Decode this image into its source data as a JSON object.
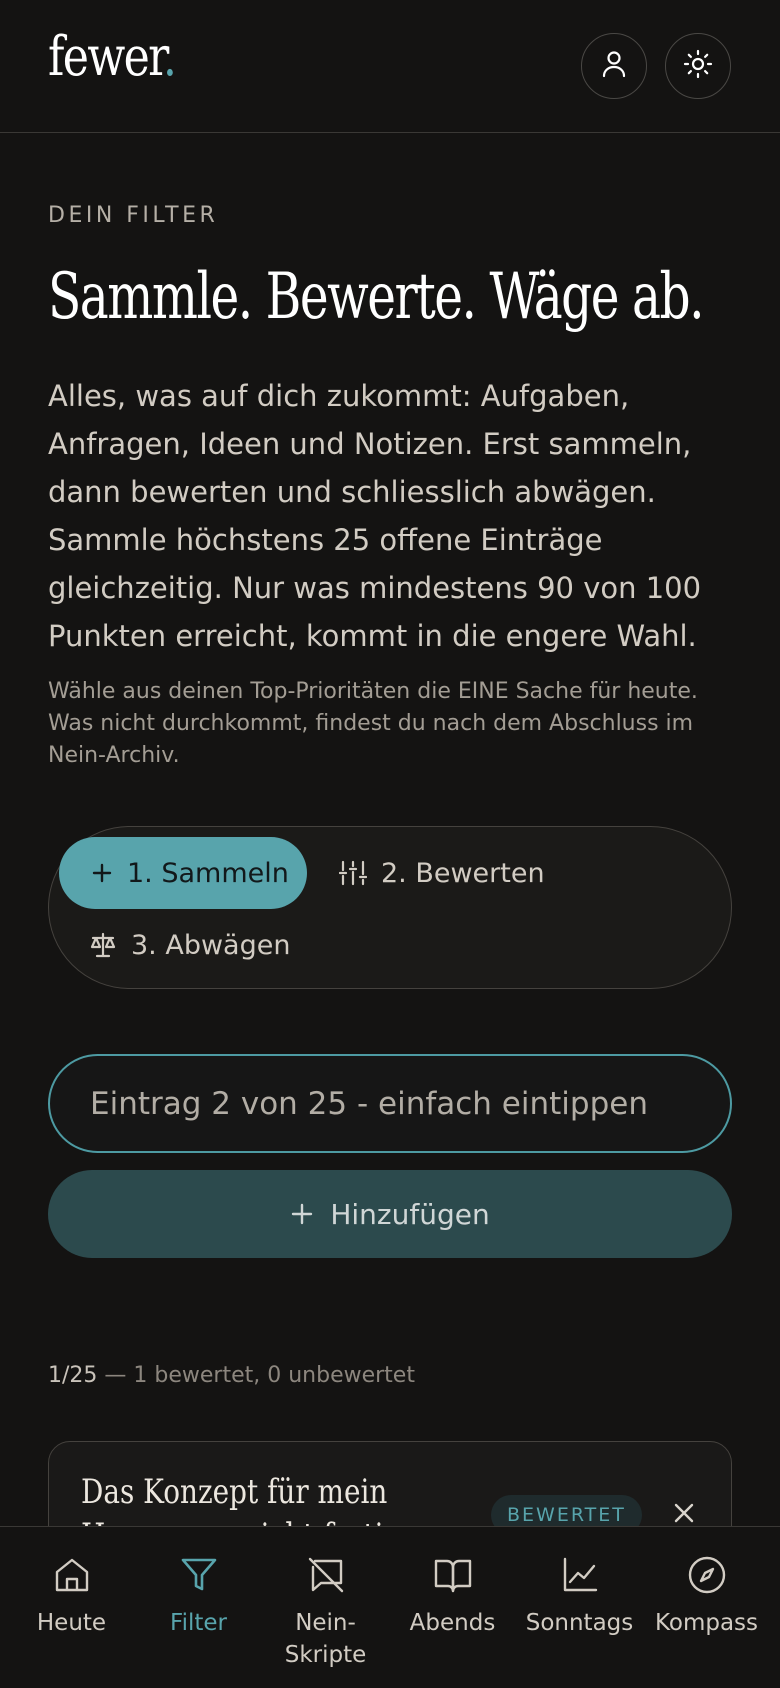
{
  "app": {
    "logo_text": "fewer",
    "logo_dot": "."
  },
  "header": {
    "user_icon": "user-icon",
    "theme_icon": "sun-icon"
  },
  "intro": {
    "eyebrow": "DEIN FILTER",
    "headline": "Sammle. Bewerte. Wäge ab.",
    "lead": "Alles, was auf dich zukommt: Aufgaben, Anfragen, Ideen und Notizen. Erst sammeln, dann bewerten und schliesslich abwägen. Sammle höchstens 25 offene Einträge gleichzeitig. Nur was mindestens 90 von 100 Punkten erreicht, kommt in die engere Wahl.",
    "note": "Wähle aus deinen Top-Prioritäten die EINE Sache für heute. Was nicht durchkommt, findest du nach dem Abschluss im Nein-Archiv."
  },
  "steps": [
    {
      "label": "1. Sammeln",
      "icon": "plus-icon",
      "active": true
    },
    {
      "label": "2. Bewerten",
      "icon": "sliders-icon",
      "active": false
    },
    {
      "label": "3. Abwägen",
      "icon": "scale-icon",
      "active": false
    }
  ],
  "entry": {
    "placeholder": "Eintrag 2 von 25 - einfach eintippen",
    "value": ""
  },
  "add_button": {
    "label": "Hinzufügen",
    "icon": "plus-icon"
  },
  "count": {
    "main": "1/25",
    "detail": " — 1 bewertet, 0 unbewertet"
  },
  "items": [
    {
      "title": "Das Konzept für mein Homepage nicht fertig stellen",
      "badge": "BEWERTET"
    }
  ],
  "bottom_nav": [
    {
      "label": "Heute",
      "icon": "home-icon",
      "active": false
    },
    {
      "label": "Filter",
      "icon": "filter-icon",
      "active": true
    },
    {
      "label": "Nein-Skripte",
      "icon": "message-off-icon",
      "active": false
    },
    {
      "label": "Abends",
      "icon": "book-icon",
      "active": false
    },
    {
      "label": "Sonntags",
      "icon": "chart-icon",
      "active": false
    },
    {
      "label": "Kompass",
      "icon": "compass-icon",
      "active": false
    }
  ],
  "colors": {
    "accent": "#58a4ac",
    "background": "#141312",
    "button_bg": "#2c4a4d"
  }
}
